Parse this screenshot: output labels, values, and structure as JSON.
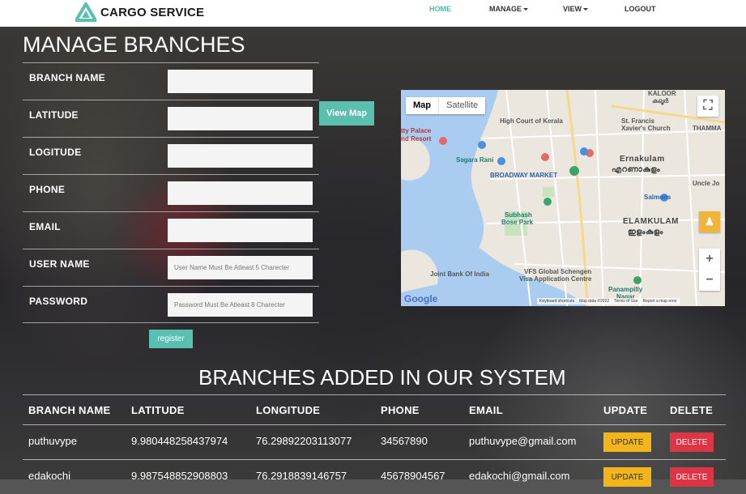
{
  "navbar": {
    "brand": "CARGO SERVICE",
    "items": [
      {
        "label": "HOME",
        "active": true
      },
      {
        "label": "MANAGE",
        "dropdown": true
      },
      {
        "label": "VIEW",
        "dropdown": true
      },
      {
        "label": "LOGOUT"
      }
    ],
    "active_color": "#4bb9a9"
  },
  "form": {
    "title": "MANAGE BRANCHES",
    "fields": [
      {
        "label": "BRANCH NAME",
        "value": "",
        "placeholder": ""
      },
      {
        "label": "LATITUDE",
        "value": "",
        "placeholder": ""
      },
      {
        "label": "LOGITUDE",
        "value": "",
        "placeholder": ""
      },
      {
        "label": "PHONE",
        "value": "",
        "placeholder": ""
      },
      {
        "label": "EMAIL",
        "value": "",
        "placeholder": ""
      },
      {
        "label": "USER NAME",
        "value": "",
        "placeholder": "User Name Must Be Atleast 5 Charecter"
      },
      {
        "label": "PASSWORD",
        "value": "",
        "placeholder": "Password Must Be Atleast 8 Charecter"
      }
    ],
    "view_map_label": "View Map",
    "register_label": "register",
    "button_color": "#5bbfb0"
  },
  "map": {
    "tabs": [
      "Map",
      "Satellite"
    ],
    "selected_tab": "Map",
    "zoom_in": "+",
    "zoom_out": "−",
    "labels": {
      "kaloor": "KALOOR",
      "kaloor_local": "കലൂർ",
      "high_court": "High Court of Kerala",
      "st_francis": "St. Francis",
      "xaviers": "Xavier's Church",
      "thamma": "THAMMA",
      "tty_palace": "tty Palace",
      "nd_resort": "nd Resort",
      "sagara": "Sagara Rani",
      "broadway": "BROADWAY MARKET",
      "ernakulam": "Ernakulam",
      "ernakulam_local": "എറണാകുളം",
      "uncle_jo": "Uncle Jo",
      "salmons": "Salmons",
      "subhash": "Subhash",
      "bose_park": "Bose Park",
      "elamkulam": "ELAMKULAM",
      "elamkulam_local": "ഇളംകുളം",
      "sbi": "Joint Bank Of India",
      "vfs": "VFS Global Schengen",
      "visa": "Visa Application Centre",
      "panampilly": "Panampilly",
      "nagar": "Nagar"
    },
    "logo": "Google",
    "footer": [
      "Keyboard shortcuts",
      "Map data ©2022",
      "Terms of Use",
      "Report a map error"
    ]
  },
  "branches": {
    "title": "BRANCHES ADDED IN OUR SYSTEM",
    "columns": [
      "BRANCH NAME",
      "LATITUDE",
      "LONGITUDE",
      "PHONE",
      "EMAIL",
      "UPDATE",
      "DELETE"
    ],
    "rows": [
      {
        "name": "puthuvype",
        "latitude": "9.980448258437974",
        "longitude": "76.29892203113077",
        "phone": "34567890",
        "email": "puthuvype@gmail.com"
      },
      {
        "name": "edakochi",
        "latitude": "9.987548852908803",
        "longitude": "76.2918839146757",
        "phone": "45678904567",
        "email": "edakochi@gmail.com"
      }
    ],
    "update_label": "UPDATE",
    "delete_label": "DELETE",
    "update_color": "#f3b51a",
    "delete_color": "#dc3545"
  }
}
